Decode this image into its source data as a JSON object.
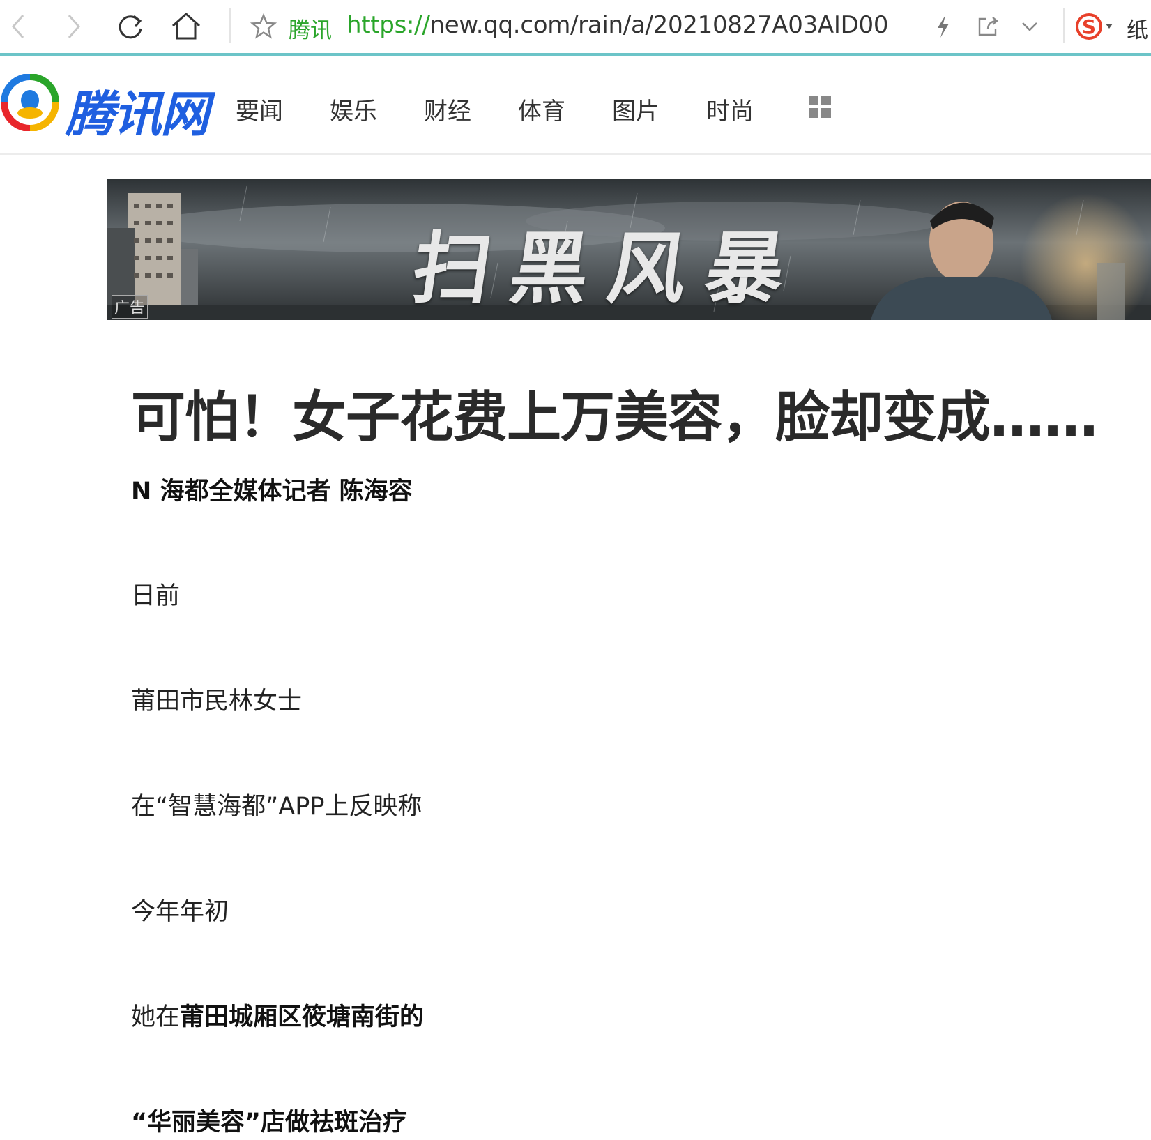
{
  "browser": {
    "site_tag": "腾讯",
    "url_scheme": "https://",
    "url_rest": "new.qq.com/rain/a/20210827A03AID00",
    "ext_label": "纸"
  },
  "site": {
    "logo_text": "腾讯网",
    "nav": [
      "要闻",
      "娱乐",
      "财经",
      "体育",
      "图片",
      "时尚"
    ]
  },
  "ad": {
    "title": "扫黑风暴",
    "tag": "广告"
  },
  "article": {
    "title": "可怕！女子花费上万美容，脸却变成……",
    "byline": "N 海都全媒体记者 陈海容",
    "p1": "日前",
    "p2": "莆田市民林女士",
    "p3": "在“智慧海都”APP上反映称",
    "p4": "今年年初",
    "p5_plain": "她在",
    "p5_bold": "莆田城厢区筱塘南街的",
    "p6": "“华丽美容”店做祛斑治疗"
  }
}
